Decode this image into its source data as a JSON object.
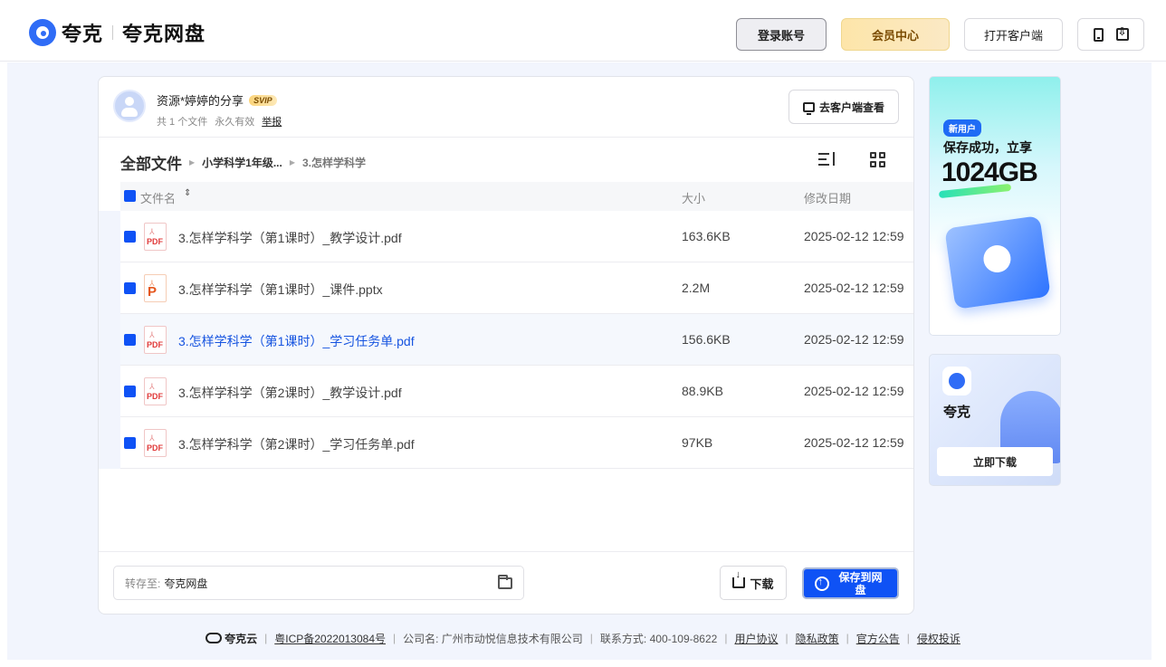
{
  "header": {
    "logo_text": "夸克",
    "logo_sub": "夸克网盘",
    "login_label": "登录账号",
    "vip_label": "会员中心",
    "client_label": "打开客户端"
  },
  "share": {
    "sharer_name": "资源*婷婷的分享",
    "badge": "SVIP",
    "file_count": "共 1 个文件",
    "validity": "永久有效",
    "report": "举报",
    "goto_client": "去客户端查看"
  },
  "breadcrumb": {
    "root": "全部文件",
    "items": [
      "小学科学1年级...",
      "3.怎样学科学"
    ]
  },
  "table": {
    "columns": [
      "文件名",
      "大小",
      "修改日期"
    ],
    "rows": [
      {
        "name": "3.怎样学科学（第1课时）_教学设计.pdf",
        "size": "163.6KB",
        "date": "2025-02-12 12:59",
        "type": "PDF"
      },
      {
        "name": "3.怎样学科学（第1课时）_课件.pptx",
        "size": "2.2M",
        "date": "2025-02-12 12:59",
        "type": "P"
      },
      {
        "name": "3.怎样学科学（第1课时）_学习任务单.pdf",
        "size": "156.6KB",
        "date": "2025-02-12 12:59",
        "type": "PDF"
      },
      {
        "name": "3.怎样学科学（第2课时）_教学设计.pdf",
        "size": "88.9KB",
        "date": "2025-02-12 12:59",
        "type": "PDF"
      },
      {
        "name": "3.怎样学科学（第2课时）_学习任务单.pdf",
        "size": "97KB",
        "date": "2025-02-12 12:59",
        "type": "PDF"
      }
    ]
  },
  "actions": {
    "saveto_label": "转存至:",
    "saveto_value": "夸克网盘",
    "download": "下载",
    "save": "保存到网盘"
  },
  "ads": {
    "ad1_badge": "新用户",
    "ad1_line1": "保存成功，立享",
    "ad1_line2": "1024GB",
    "ad2_name": "夸克",
    "ad2_button": "立即下载"
  },
  "footer": {
    "brand": "夸克云",
    "icp": "粤ICP备2022013084号",
    "company": "公司名: 广州市动悦信息技术有限公司",
    "contact": "联系方式: 400-109-8622",
    "links": [
      "用户协议",
      "隐私政策",
      "官方公告",
      "侵权投诉"
    ]
  },
  "colors": {
    "accent": "#0f52f5",
    "active_link": "#1654e0",
    "page_bg": "#f2f5fd"
  }
}
